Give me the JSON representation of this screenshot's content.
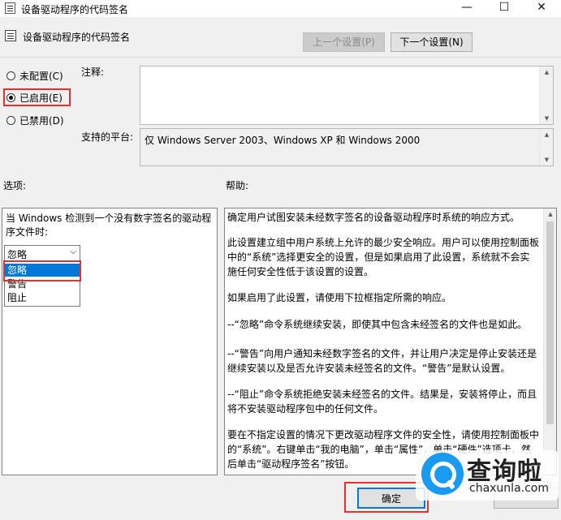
{
  "window": {
    "title": "设备驱动程序的代码签名",
    "minimize_glyph": "—",
    "maximize_glyph": "☐",
    "close_glyph": "✕"
  },
  "header": {
    "policy_name": "设备驱动程序的代码签名",
    "prev_button": "上一个设置(P)",
    "next_button": "下一个设置(N)"
  },
  "state": {
    "options": [
      {
        "label": "未配置(C)",
        "checked": false
      },
      {
        "label": "已启用(E)",
        "checked": true
      },
      {
        "label": "已禁用(D)",
        "checked": false
      }
    ]
  },
  "comment": {
    "label": "注释:",
    "value": ""
  },
  "platform": {
    "label": "支持的平台:",
    "value": "仅 Windows Server 2003、Windows XP 和 Windows 2000"
  },
  "options_panel": {
    "heading": "选项:",
    "description": "当 Windows 检测到一个没有数字签名的驱动程序文件时:",
    "selected": "忽略",
    "dropdown_items": [
      "忽略",
      "警告",
      "阻止"
    ]
  },
  "help_panel": {
    "heading": "帮助:",
    "paragraphs": [
      "确定用户试图安装未经数字签名的设备驱动程序时系统的响应方式。",
      "此设置建立组中用户系统上允许的最少安全响应。用户可以使用控制面板中的“系统”选择更安全的设置，但是如果启用了此设置，系统就不会实施任何安全性低于该设置的设置。",
      "如果启用了此设置，请使用下拉框指定所需的响应。",
      "--“忽略”命令系统继续安装，即使其中包含未经签名的文件也是如此。",
      "--“警告”向用户通知未经数字签名的文件，并让用户决定是停止安装还是继续安装以及是否允许安装未经签名的文件。“警告”是默认设置。",
      "--“阻止”命令系统拒绝安装未经签名的文件。结果是，安装将停止，而且将不安装驱动程序包中的任何文件。",
      "要在不指定设置的情况下更改驱动程序文件的安全性，请使用控制面板中的“系统”。右键单击“我的电脑”，单击“属性”，单击“硬件”选项卡，然后单击“驱动程序签名”按钮。"
    ]
  },
  "footer": {
    "ok_button": "确定"
  },
  "watermark": {
    "brand": "查询啦",
    "url": "chaxunla.com"
  },
  "colors": {
    "highlight": "#e0322f",
    "selection": "#0078d7",
    "watermark": "#1a9af0"
  }
}
